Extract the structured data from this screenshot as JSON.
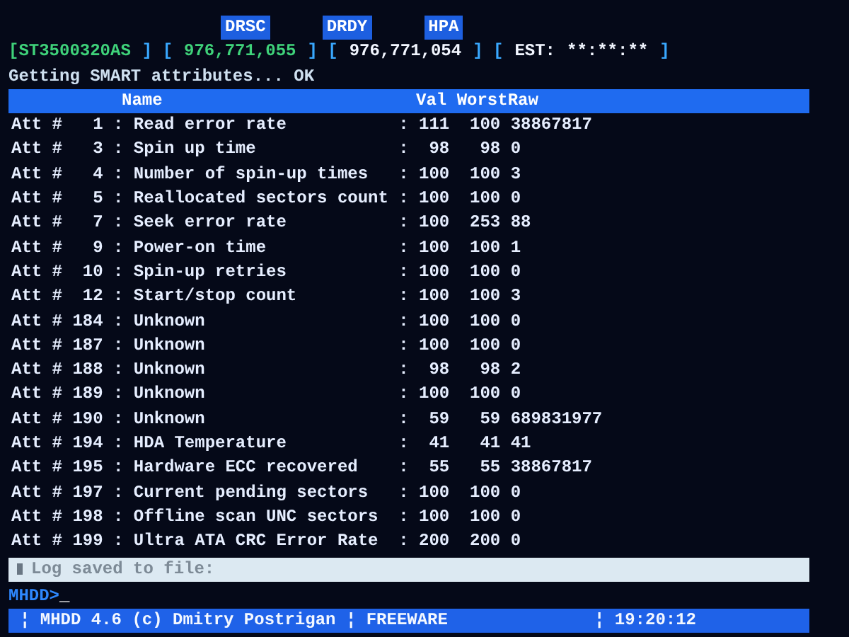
{
  "flags": [
    {
      "label": "DRSC",
      "on": true
    },
    {
      "label": "DRDY",
      "on": true
    },
    {
      "label": "HPA",
      "on": true
    }
  ],
  "info": [
    {
      "text": "[ST3500320AS",
      "kind": "green"
    },
    {
      "text": "] [",
      "kind": "bracket"
    },
    {
      "text": "976,771,055",
      "kind": "green"
    },
    {
      "text": "] [",
      "kind": "bracket"
    },
    {
      "text": "976,771,054",
      "kind": "white"
    },
    {
      "text": "] [",
      "kind": "bracket"
    },
    {
      "text": "EST:",
      "kind": "white"
    },
    {
      "text": "**:**:**",
      "kind": "white"
    },
    {
      "text": "]",
      "kind": "bracket"
    }
  ],
  "message": "Getting SMART attributes... OK",
  "table": {
    "columns": [
      "Name",
      "Val",
      "Worst",
      "Raw"
    ],
    "rows": [
      {
        "attribute": "Att #   1 : Read error rate",
        "sep": ":",
        "val": "111",
        "worst": "100",
        "raw": "38867817"
      },
      {
        "attribute": "Att #   3 : Spin up time",
        "sep": ":",
        "val": "98",
        "worst": "98",
        "raw": "0"
      },
      {
        "attribute": "Att #   4 : Number of spin-up times",
        "sep": ":",
        "val": "100",
        "worst": "100",
        "raw": "3"
      },
      {
        "attribute": "Att #   5 : Reallocated sectors count",
        "sep": ":",
        "val": "100",
        "worst": "100",
        "raw": "0"
      },
      {
        "attribute": "Att #   7 : Seek error rate",
        "sep": ":",
        "val": "100",
        "worst": "253",
        "raw": "88"
      },
      {
        "attribute": "Att #   9 : Power-on time",
        "sep": ":",
        "val": "100",
        "worst": "100",
        "raw": "1"
      },
      {
        "attribute": "Att #  10 : Spin-up retries",
        "sep": ":",
        "val": "100",
        "worst": "100",
        "raw": "0"
      },
      {
        "attribute": "Att #  12 : Start/stop count",
        "sep": ":",
        "val": "100",
        "worst": "100",
        "raw": "3"
      },
      {
        "attribute": "Att # 184 : Unknown",
        "sep": ":",
        "val": "100",
        "worst": "100",
        "raw": "0"
      },
      {
        "attribute": "Att # 187 : Unknown",
        "sep": ":",
        "val": "100",
        "worst": "100",
        "raw": "0"
      },
      {
        "attribute": "Att # 188 : Unknown",
        "sep": ":",
        "val": "98",
        "worst": "98",
        "raw": "2"
      },
      {
        "attribute": "Att # 189 : Unknown",
        "sep": ":",
        "val": "100",
        "worst": "100",
        "raw": "0"
      },
      {
        "attribute": "Att # 190 : Unknown",
        "sep": ":",
        "val": "59",
        "worst": "59",
        "raw": "689831977"
      },
      {
        "attribute": "Att # 194 : HDA Temperature",
        "sep": ":",
        "val": "41",
        "worst": "41",
        "raw": "41"
      },
      {
        "attribute": "Att # 195 : Hardware ECC recovered",
        "sep": ":",
        "val": "55",
        "worst": "55",
        "raw": "38867817"
      },
      {
        "attribute": "Att # 197 : Current pending sectors",
        "sep": ":",
        "val": "100",
        "worst": "100",
        "raw": "0"
      },
      {
        "attribute": "Att # 198 : Offline scan UNC sectors",
        "sep": ":",
        "val": "100",
        "worst": "100",
        "raw": "0"
      },
      {
        "attribute": "Att # 199 : Ultra ATA CRC Error Rate",
        "sep": ":",
        "val": "200",
        "worst": "200",
        "raw": "0"
      }
    ]
  },
  "log": "Log saved to file:",
  "prompt": "MHDD>",
  "cursor": "_",
  "status_bar": {
    "left": "¦ MHDD 4.6 (c) Dmitry Postrigan ¦ FREEWARE",
    "right": "¦ 19:20:12"
  }
}
